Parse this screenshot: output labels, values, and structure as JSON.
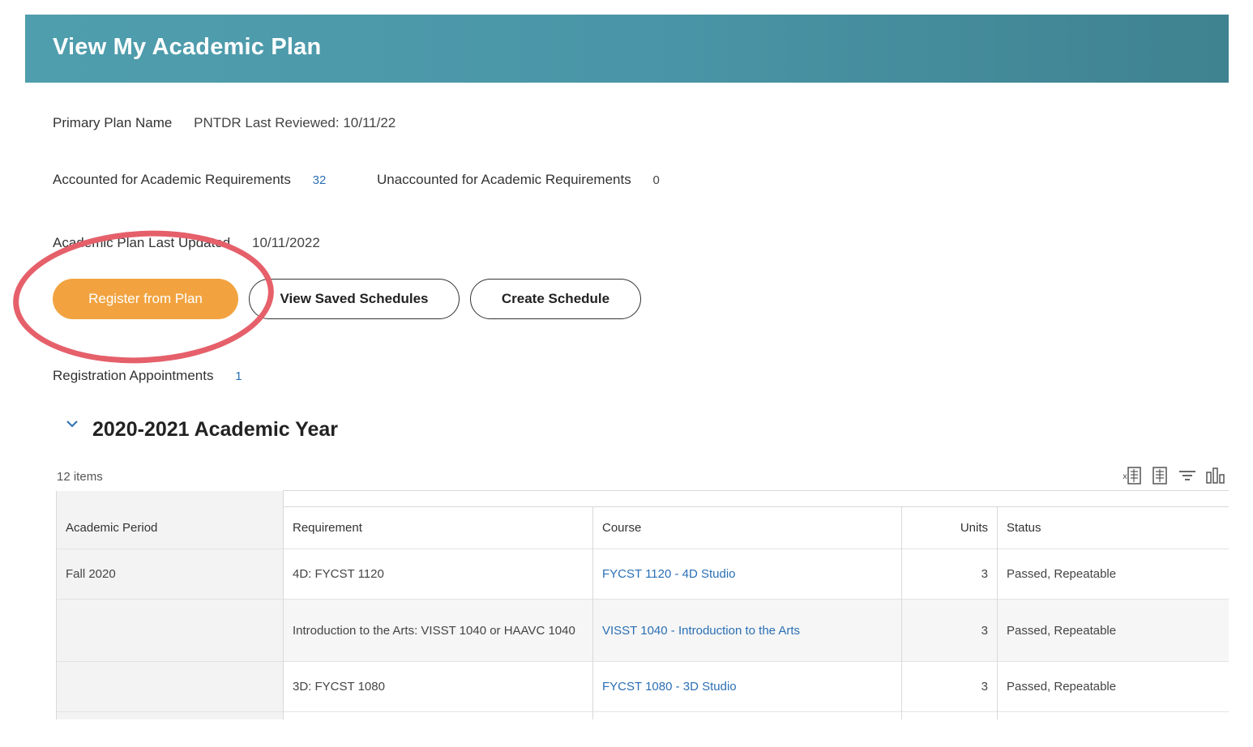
{
  "header": {
    "title": "View My Academic Plan"
  },
  "plan": {
    "primary_label": "Primary Plan Name",
    "primary_value": "PNTDR Last Reviewed: 10/11/22",
    "accounted_label": "Accounted for Academic Requirements",
    "accounted_value": "32",
    "unaccounted_label": "Unaccounted for Academic Requirements",
    "unaccounted_value": "0",
    "updated_label": "Academic Plan Last Updated",
    "updated_value": "10/11/2022",
    "registration_label": "Registration Appointments",
    "registration_value": "1"
  },
  "buttons": {
    "register": "Register from Plan",
    "saved": "View Saved Schedules",
    "create": "Create Schedule"
  },
  "section": {
    "title": "2020-2021 Academic Year",
    "items_count": "12 items"
  },
  "table": {
    "headers": {
      "period": "Academic Period",
      "requirement": "Requirement",
      "course": "Course",
      "units": "Units",
      "status": "Status"
    },
    "rows": [
      {
        "period": "Fall 2020",
        "requirement": "4D: FYCST 1120",
        "course": "FYCST 1120 - 4D Studio",
        "units": "3",
        "status": "Passed, Repeatable"
      },
      {
        "period": "",
        "requirement": "Introduction to the Arts: VISST 1040 or HAAVC 1040",
        "course": "VISST 1040 - Introduction to the Arts",
        "units": "3",
        "status": "Passed, Repeatable"
      },
      {
        "period": "",
        "requirement": "3D: FYCST 1080",
        "course": "FYCST 1080 - 3D Studio",
        "units": "3",
        "status": "Passed, Repeatable"
      }
    ]
  },
  "icons": [
    "export-excel-icon",
    "export-pdf-icon",
    "filter-icon",
    "chart-icon"
  ],
  "colors": {
    "header": "#4a96a8",
    "primary_button": "#f2a340",
    "annotation": "#e5606a",
    "link": "#2a6fb5"
  }
}
